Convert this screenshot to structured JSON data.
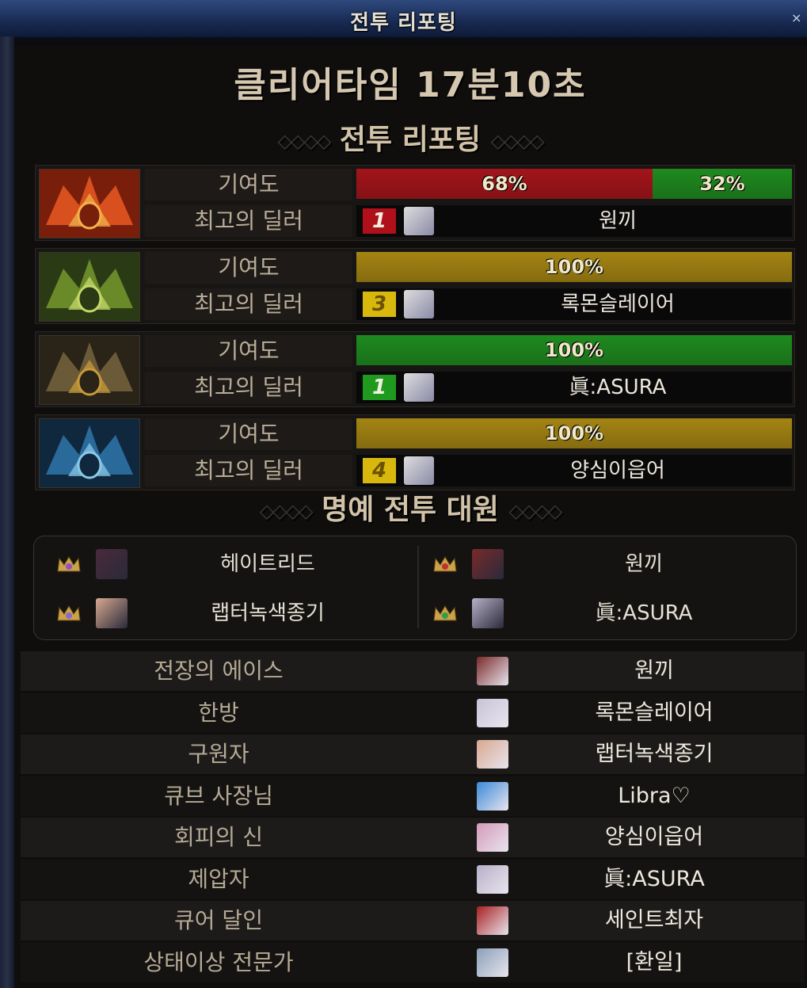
{
  "window": {
    "title": "전투 리포팅",
    "close_icon": "close-icon"
  },
  "clear_time": "클리어타임 17분10초",
  "report_section_title": "전투 리포팅",
  "reports": [
    {
      "icon": "fire-crest-icon",
      "contribution_label": "기여도",
      "segments": [
        {
          "value": "68%",
          "color": "#a3141a"
        },
        {
          "value": "32%",
          "color": "#1e8a1e"
        }
      ],
      "dealer_label": "최고의 딜러",
      "rank": "1",
      "rank_color": "#b0101a",
      "dealer": "원끼"
    },
    {
      "icon": "green-crest-icon",
      "contribution_label": "기여도",
      "segments": [
        {
          "value": "100%",
          "color": "#a48412"
        }
      ],
      "dealer_label": "최고의 딜러",
      "rank": "3",
      "rank_color": "#d9b80e",
      "dealer": "록몬슬레이어"
    },
    {
      "icon": "gold-crest-icon",
      "contribution_label": "기여도",
      "segments": [
        {
          "value": "100%",
          "color": "#1e8a1e"
        }
      ],
      "dealer_label": "최고의 딜러",
      "rank": "1",
      "rank_color": "#1f9a1f",
      "dealer": "眞:ASURA"
    },
    {
      "icon": "blue-crest-icon",
      "contribution_label": "기여도",
      "segments": [
        {
          "value": "100%",
          "color": "#a48412"
        }
      ],
      "dealer_label": "최고의 딜러",
      "rank": "4",
      "rank_color": "#d9b80e",
      "dealer": "양심이읍어"
    }
  ],
  "honor_section_title": "명예 전투 대원",
  "honor_members": [
    {
      "name": "헤이트리드",
      "crown_gem": "#9a4cc8",
      "portrait": "#4a2a3a"
    },
    {
      "name": "원끼",
      "crown_gem": "#c23030",
      "portrait": "#7a2a2a"
    },
    {
      "name": "랩터녹색종기",
      "crown_gem": "#8a6ac8",
      "portrait": "#d8a890"
    },
    {
      "name": "眞:ASURA",
      "crown_gem": "#2fa04a",
      "portrait": "#b8b0c8"
    }
  ],
  "awards": [
    {
      "title": "전장의 에이스",
      "player": "원끼",
      "portrait": "#7a2a2a"
    },
    {
      "title": "한방",
      "player": "록몬슬레이어",
      "portrait": "#c8c4d8"
    },
    {
      "title": "구원자",
      "player": "랩터녹색종기",
      "portrait": "#d8a890"
    },
    {
      "title": "큐브 사장님",
      "player": "Libra♡",
      "portrait": "#3a8ad8"
    },
    {
      "title": "회피의 신",
      "player": "양심이읍어",
      "portrait": "#d49ab8"
    },
    {
      "title": "제압자",
      "player": "眞:ASURA",
      "portrait": "#b8b0c8"
    },
    {
      "title": "큐어 달인",
      "player": "세인트최자",
      "portrait": "#a82020"
    },
    {
      "title": "상태이상 전문가",
      "player": "[환일]",
      "portrait": "#8aa0b8"
    }
  ]
}
